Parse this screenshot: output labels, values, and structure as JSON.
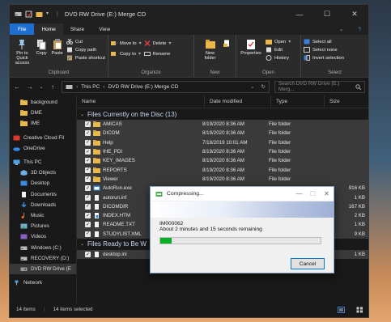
{
  "window": {
    "title": "DVD RW Drive (E:) Merge CD",
    "controls": [
      "—",
      "☐",
      "✕"
    ]
  },
  "ribbon": {
    "tabs": [
      "File",
      "Home",
      "Share",
      "View"
    ],
    "clipboard": {
      "label": "Clipboard",
      "pin": "Pin to Quick access",
      "copy": "Copy",
      "paste": "Paste",
      "cut": "Cut",
      "copy_path": "Copy path",
      "paste_shortcut": "Paste shortcut"
    },
    "organize": {
      "label": "Organize",
      "move_to": "Move to",
      "copy_to": "Copy to",
      "delete": "Delete",
      "rename": "Rename"
    },
    "new": {
      "label": "New",
      "new_folder": "New folder"
    },
    "open": {
      "label": "Open",
      "properties": "Properties",
      "open": "Open",
      "edit": "Edit",
      "history": "History"
    },
    "select": {
      "label": "Select",
      "select_all": "Select all",
      "select_none": "Select none",
      "invert": "Invert selection"
    }
  },
  "address": {
    "this_pc": "This PC",
    "drive": "DVD RW Drive (E:) Merge CD",
    "search_placeholder": "Search DVD RW Drive (E:) Merg..."
  },
  "sidebar": {
    "items": [
      {
        "label": "background",
        "icon": "folder-icon"
      },
      {
        "label": "DME",
        "icon": "folder-icon"
      },
      {
        "label": "IME",
        "icon": "folder-icon"
      },
      {
        "label": "Creative Cloud Fil",
        "icon": "cloud-icon"
      },
      {
        "label": "OneDrive",
        "icon": "onedrive-icon"
      },
      {
        "label": "This PC",
        "icon": "pc-icon"
      },
      {
        "label": "3D Objects",
        "icon": "cube-icon"
      },
      {
        "label": "Desktop",
        "icon": "desktop-icon"
      },
      {
        "label": "Documents",
        "icon": "document-icon"
      },
      {
        "label": "Downloads",
        "icon": "download-icon"
      },
      {
        "label": "Music",
        "icon": "music-icon"
      },
      {
        "label": "Pictures",
        "icon": "picture-icon"
      },
      {
        "label": "Videos",
        "icon": "video-icon"
      },
      {
        "label": "Windows (C:)",
        "icon": "drive-icon"
      },
      {
        "label": "RECOVERY (D:)",
        "icon": "drive-icon"
      },
      {
        "label": "DVD RW Drive (E",
        "icon": "dvd-icon"
      },
      {
        "label": "Network",
        "icon": "network-icon"
      }
    ]
  },
  "columns": {
    "name": "Name",
    "date": "Date modified",
    "type": "Type",
    "size": "Size"
  },
  "groups": {
    "on_disc": "Files Currently on the Disc (13)",
    "ready": "Files Ready to Be W"
  },
  "files": [
    {
      "name": "AMICAS",
      "date": "8/19/2020 8:36 AM",
      "type": "File folder",
      "size": "",
      "kind": "folder"
    },
    {
      "name": "DICOM",
      "date": "8/19/2020 8:36 AM",
      "type": "File folder",
      "size": "",
      "kind": "folder"
    },
    {
      "name": "Help",
      "date": "7/18/2019 10:01 AM",
      "type": "File folder",
      "size": "",
      "kind": "folder"
    },
    {
      "name": "IHE_PDI",
      "date": "8/19/2020 8:36 AM",
      "type": "File folder",
      "size": "",
      "kind": "folder"
    },
    {
      "name": "KEY_IMAGES",
      "date": "8/19/2020 8:36 AM",
      "type": "File folder",
      "size": "",
      "kind": "folder"
    },
    {
      "name": "REPORTS",
      "date": "8/19/2020 8:36 AM",
      "type": "File folder",
      "size": "",
      "kind": "folder"
    },
    {
      "name": "Viewer",
      "date": "8/19/2020 8:36 AM",
      "type": "File folder",
      "size": "",
      "kind": "folder"
    },
    {
      "name": "AutoRun.exe",
      "date": "",
      "type": "",
      "size": "916 KB",
      "kind": "exe"
    },
    {
      "name": "autorun.inf",
      "date": "",
      "type": "",
      "size": "1 KB",
      "kind": "file"
    },
    {
      "name": "DICOMDIR",
      "date": "",
      "type": "",
      "size": "167 KB",
      "kind": "file"
    },
    {
      "name": "INDEX.HTM",
      "date": "",
      "type": "",
      "size": "2 KB",
      "kind": "htm"
    },
    {
      "name": "README.TXT",
      "date": "",
      "type": "",
      "size": "1 KB",
      "kind": "file"
    },
    {
      "name": "STUDYLIST.XML",
      "date": "",
      "type": "",
      "size": "9 KB",
      "kind": "file"
    }
  ],
  "ready_files": [
    {
      "name": "desktop.ini",
      "size": "1 KB"
    }
  ],
  "status": {
    "count": "14 items",
    "selected": "14 items selected"
  },
  "dialog": {
    "title": "Compressing...",
    "file": "IM000062",
    "remaining": "About 2 minutes and 15 seconds remaining",
    "progress": 0.07,
    "cancel": "Cancel"
  }
}
